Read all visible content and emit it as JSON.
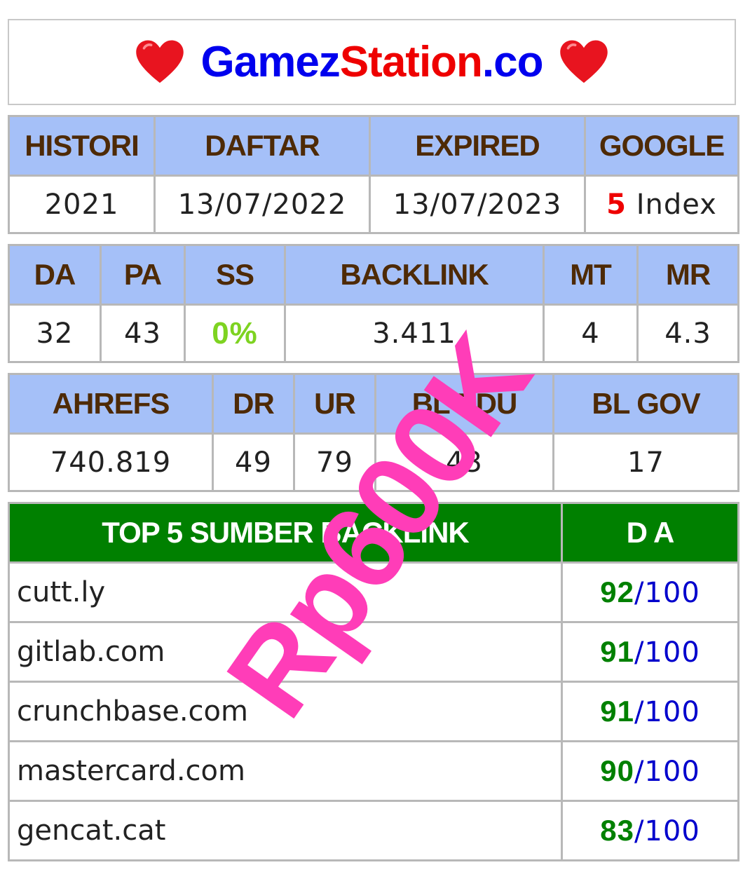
{
  "header": {
    "title_part1": "Gamez",
    "title_part2": "Station",
    "title_part3": ".co"
  },
  "table1": {
    "headers": [
      "HISTORI",
      "DAFTAR",
      "EXPIRED",
      "GOOGLE"
    ],
    "values": [
      "2021",
      "13/07/2022",
      "13/07/2023"
    ],
    "google_count": "5",
    "google_label": " Index"
  },
  "table2": {
    "headers": [
      "DA",
      "PA",
      "SS",
      "BACKLINK",
      "MT",
      "MR"
    ],
    "values": [
      "32",
      "43",
      "0%",
      "3.411",
      "4",
      "4.3"
    ]
  },
  "table3": {
    "headers": [
      "AHREFS",
      "DR",
      "UR",
      "BL EDU",
      "BL GOV"
    ],
    "values": [
      "740.819",
      "49",
      "79",
      "43",
      "17"
    ]
  },
  "table4": {
    "headers": [
      "TOP 5 SUMBER BACKLINK",
      "D A"
    ],
    "rows": [
      {
        "site": "cutt.ly",
        "da": "92",
        "max": "/100"
      },
      {
        "site": "gitlab.com",
        "da": "91",
        "max": "/100"
      },
      {
        "site": "crunchbase.com",
        "da": "91",
        "max": "/100"
      },
      {
        "site": "mastercard.com",
        "da": "90",
        "max": "/100"
      },
      {
        "site": "gencat.cat",
        "da": "83",
        "max": "/100"
      }
    ]
  },
  "stamp": "Rp600K",
  "colors": {
    "header_blue": "#a5c0f8",
    "header_green": "#008000",
    "stamp_pink": "#ff3db8"
  },
  "icons": [
    "heart-icon",
    "heart-icon"
  ]
}
